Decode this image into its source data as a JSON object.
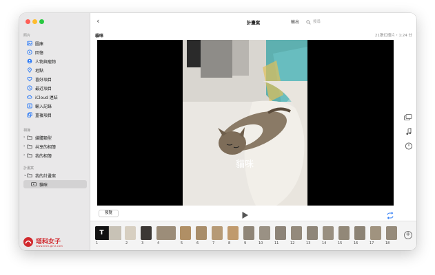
{
  "window": {
    "controls": [
      "close",
      "minimize",
      "zoom"
    ]
  },
  "sidebar": {
    "photos_section": "照片",
    "photo_items": [
      {
        "label": "圖庫",
        "icon": "library-icon"
      },
      {
        "label": "回憶",
        "icon": "memories-icon"
      },
      {
        "label": "人物與寵物",
        "icon": "people-icon"
      },
      {
        "label": "地點",
        "icon": "places-icon"
      },
      {
        "label": "喜好項目",
        "icon": "heart-icon"
      },
      {
        "label": "最近項目",
        "icon": "clock-icon"
      },
      {
        "label": "iCloud 連結",
        "icon": "cloud-link-icon"
      },
      {
        "label": "輸入記錄",
        "icon": "import-icon"
      },
      {
        "label": "重複項目",
        "icon": "duplicate-icon"
      }
    ],
    "albums_section": "相簿",
    "album_items": [
      {
        "label": "媒體類型",
        "icon": "folder-icon"
      },
      {
        "label": "共享的相簿",
        "icon": "shared-folder-icon"
      },
      {
        "label": "我的相簿",
        "icon": "folder-icon"
      }
    ],
    "projects_section": "計畫案",
    "project_items": [
      {
        "label": "我的計畫案",
        "icon": "folder-icon"
      },
      {
        "label": "貓咪",
        "icon": "slideshow-icon",
        "selected": true
      }
    ]
  },
  "toolbar": {
    "back_icon": "chevron-left-icon",
    "title": "計畫案",
    "export_label": "輸出",
    "search_placeholder": "搜尋"
  },
  "project": {
    "name": "貓咪",
    "meta": "21張幻燈片・1:24 分",
    "caption": "貓咪"
  },
  "controls": {
    "preview_label": "預覽",
    "play_icon": "play-icon",
    "loop_icon": "loop-icon"
  },
  "side_tools": [
    "theme-icon",
    "music-icon",
    "duration-icon"
  ],
  "filmstrip": {
    "clips": [
      "1",
      "2",
      "3",
      "4",
      "5",
      "6",
      "7",
      "8",
      "9",
      "10",
      "11",
      "12",
      "13",
      "14",
      "15",
      "16",
      "17",
      "18"
    ],
    "title_glyph": "T",
    "add_icon": "add-icon"
  },
  "watermark": {
    "brand": "塔科女子",
    "url": "www.tech-girlz.com"
  },
  "colors": {
    "accent": "#2f7cf6",
    "sidebar_bg": "#e9e8e9",
    "logo": "#d1282d"
  }
}
